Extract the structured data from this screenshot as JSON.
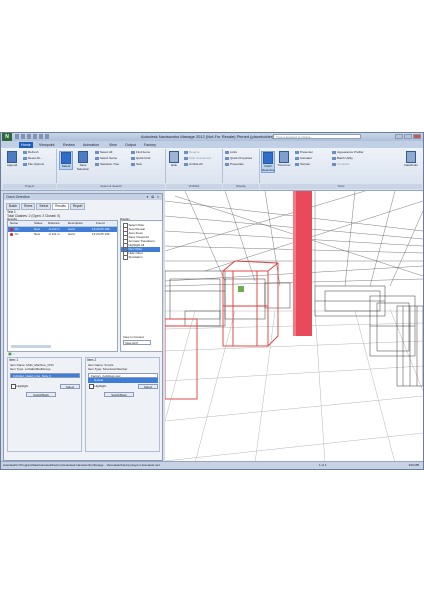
{
  "app": {
    "title": "Autodesk Navisworks Manage 2012 (Not For Resale)  Pinned (placeholder)",
    "search_placeholder": "Type a keyword or phrase",
    "logo": "N"
  },
  "ribbon": {
    "tabs": [
      "Home",
      "Viewpoint",
      "Review",
      "Animation",
      "View",
      "Output",
      "Factory"
    ],
    "active_tab": "Home",
    "groups": [
      {
        "label": "Project",
        "items": [
          "Append",
          "Refresh",
          "Reset All...",
          "File Options"
        ]
      },
      {
        "label": "Select & Search",
        "items": [
          "Select",
          "Save Selection",
          "Select All",
          "Select Same",
          "Selection Tree",
          "Find Items",
          "Quick Find",
          "Sets"
        ]
      },
      {
        "label": "Visibility",
        "items": [
          "Hide",
          "Require",
          "Hide Unselected",
          "Unhide All"
        ]
      },
      {
        "label": "Display",
        "items": [
          "Links",
          "Quick Properties",
          "Properties"
        ]
      },
      {
        "label": "Tools",
        "items": [
          "Clash Detective",
          "TimeLiner",
          "Presenter",
          "Animator",
          "Scripter",
          "Appearance Profiler",
          "Batch Utility",
          "Compare",
          "DataTools"
        ]
      }
    ]
  },
  "panel": {
    "title": "Clash Detective",
    "tabs": [
      "Batch",
      "Rules",
      "Select",
      "Results",
      "Report"
    ],
    "active_tab": "Results",
    "test_name": "Test 1",
    "summary": "Total Clashes: 2 (Open: 2  Closed: 0)",
    "results_label": "Results",
    "columns": [
      "Name",
      "Status",
      "Distance",
      "Description",
      "Found"
    ],
    "rows": [
      {
        "name": "Cl...",
        "status": "New",
        "distance": "-0.142 m",
        "description": "Hard",
        "found": "13:24:05 1/8/...",
        "selected": true
      },
      {
        "name": "Cl...",
        "status": "New",
        "distance": "-0.141 m",
        "description": "Hard",
        "found": "13:24:05 1/8/...",
        "selected": false
      }
    ],
    "display_label": "Display",
    "display_options": [
      {
        "label": "Select Filter",
        "checked": false
      },
      {
        "label": "Auto Reveal",
        "checked": false
      },
      {
        "label": "Auto Zoom",
        "checked": true
      },
      {
        "label": "Save Viewpoint",
        "checked": false
      },
      {
        "label": "Animate Transitions",
        "checked": false
      },
      {
        "label": "Highlight All",
        "checked": false
      },
      {
        "label": "Dim Other",
        "checked": true
      },
      {
        "label": "Hide Other",
        "checked": false
      },
      {
        "label": "Simulation",
        "checked": false
      }
    ],
    "display_selected": "Dim Other",
    "view_in_context_label": "View in Context",
    "view_in_context_value": "View All",
    "item1": {
      "header": "Item 1",
      "name_line": "Item Name: Multi_Machine_CNC",
      "type_line": "Item Type: LcOaExShellGroup",
      "tree_root": "Cylinder_Head_Line_New_F",
      "highlight": "Highlight",
      "select_label": "Select",
      "switchback_label": "SwitchBack"
    },
    "item2": {
      "header": "Item 2",
      "name_line": "Item Name: S-Cols",
      "type_line": "Item Type: Structural Member",
      "tree_root": "Factory_buildings.nwc",
      "tree_child": "S-Cols",
      "highlight": "Highlight",
      "select_label": "Select",
      "switchback_label": "SwitchBack"
    }
  },
  "status": {
    "path": "Autodesk\\C:\\ProgramData\\Autodesk\\Factory\\Autodesk Navisworks Manage  ...\\Autodesk\\Factory\\Layout.Autodesk.nwf",
    "page": "1 of 1",
    "memory": "493 MB"
  },
  "colors": {
    "clash_red": "#e03a3a",
    "accent": "#1f5fb8",
    "selection": "#3e7ed6"
  }
}
